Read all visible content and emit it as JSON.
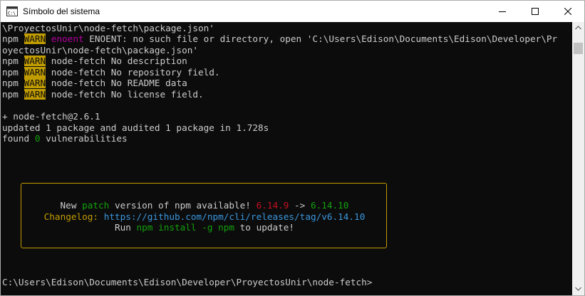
{
  "window": {
    "title": "Símbolo del sistema",
    "icon": "cmd-icon"
  },
  "colors": {
    "background": "#0c0c0c",
    "text": "#cccccc",
    "warn_bg": "#c19c00",
    "magenta": "#b4009e",
    "green": "#13a10e",
    "red": "#c50f1f",
    "yellow": "#c19c00",
    "cyan": "#3a96dd"
  },
  "console": {
    "line1": "\\ProyectosUnir\\node-fetch\\package.json'",
    "line2": {
      "prefix": "npm ",
      "tag": "WARN",
      "code": "enoent",
      "message": " ENOENT: no such file or directory, open 'C:\\Users\\Edison\\Documents\\Edison\\Developer\\Pr"
    },
    "line3": "oyectosUnir\\node-fetch\\package.json'",
    "warnings": [
      {
        "prefix": "npm ",
        "tag": "WARN",
        "message": " node-fetch No description"
      },
      {
        "prefix": "npm ",
        "tag": "WARN",
        "message": " node-fetch No repository field."
      },
      {
        "prefix": "npm ",
        "tag": "WARN",
        "message": " node-fetch No README data"
      },
      {
        "prefix": "npm ",
        "tag": "WARN",
        "message": " node-fetch No license field."
      }
    ],
    "installed": "+ node-fetch@2.6.1",
    "updated": "updated 1 package and audited 1 package in 1.728s",
    "found": {
      "before": "found ",
      "count": "0",
      "after": " vulnerabilities"
    },
    "update_notice": {
      "l1_a": "New ",
      "l1_b": "patch",
      "l1_c": " version of npm available! ",
      "l1_old": "6.14.9",
      "l1_arrow": " -> ",
      "l1_new": "6.14.10",
      "l2_label": "Changelog: ",
      "l2_url": "https://github.com/npm/cli/releases/tag/v6.14.10",
      "l3_a": "Run ",
      "l3_cmd": "npm install -g npm",
      "l3_b": " to update!"
    },
    "prompt": "C:\\Users\\Edison\\Documents\\Edison\\Developer\\ProyectosUnir\\node-fetch>"
  }
}
